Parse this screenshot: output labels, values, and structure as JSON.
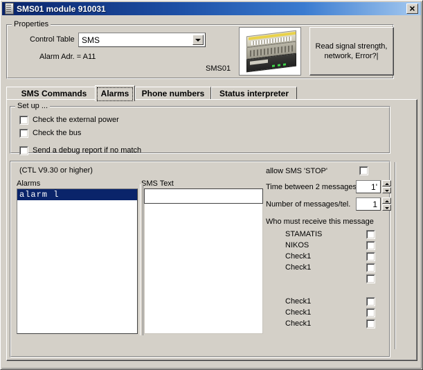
{
  "window": {
    "title": "SMS01 module 910031",
    "icon": "module-icon",
    "close_label": "×"
  },
  "properties": {
    "group_title": "Properties",
    "control_table_label": "Control Table",
    "control_table_value": "SMS",
    "control_table_options": [
      "SMS"
    ],
    "alarm_adr_label": "Alarm Adr. = A11",
    "module_caption": "SMS01",
    "module_image_alt": "sms01-module-photo",
    "read_button_line1": "Read signal strength,",
    "read_button_line2": "network, Error?|"
  },
  "tabs": {
    "items": [
      {
        "label": "SMS Commands",
        "active": false
      },
      {
        "label": "Alarms",
        "active": true
      },
      {
        "label": "Phone numbers",
        "active": false
      },
      {
        "label": "Status interpreter",
        "active": false
      }
    ]
  },
  "setup": {
    "group_title": "Set up ...",
    "checkboxes": [
      {
        "label": "Check the external power",
        "checked": false
      },
      {
        "label": "Check the bus",
        "checked": false
      },
      {
        "label": "Send a debug report if no match",
        "checked": false
      }
    ]
  },
  "alarms_panel": {
    "version_note": "(CTL V9.30 or higher)",
    "alarms_label": "Alarms",
    "sms_text_label": "SMS Text",
    "alarms_list": [
      {
        "text": "alarm l",
        "selected": true
      }
    ],
    "sms_text_value": "",
    "sms_text_placeholder": ""
  },
  "message_options": {
    "allow_stop_label": "allow SMS 'STOP'",
    "allow_stop_checked": false,
    "time_between_label": "Time between 2 messages",
    "time_between_value": "1'",
    "number_per_tel_label": "Number of messages/tel.",
    "number_per_tel_value": "1"
  },
  "recipients": {
    "title": "Who must receive this message",
    "rows": [
      {
        "name": "STAMATIS",
        "checked": false
      },
      {
        "name": "NIKOS",
        "checked": false
      },
      {
        "name": "Check1",
        "checked": false
      },
      {
        "name": "Check1",
        "checked": false
      },
      {
        "name": "",
        "checked": false
      },
      {
        "name": "Check1",
        "checked": false
      },
      {
        "name": "Check1",
        "checked": false
      },
      {
        "name": "Check1",
        "checked": false
      }
    ]
  },
  "colors": {
    "face": "#d4d0c8",
    "title_start": "#0a246a",
    "title_end": "#a6caf0",
    "selection": "#0a246a",
    "field": "#ffffff"
  }
}
